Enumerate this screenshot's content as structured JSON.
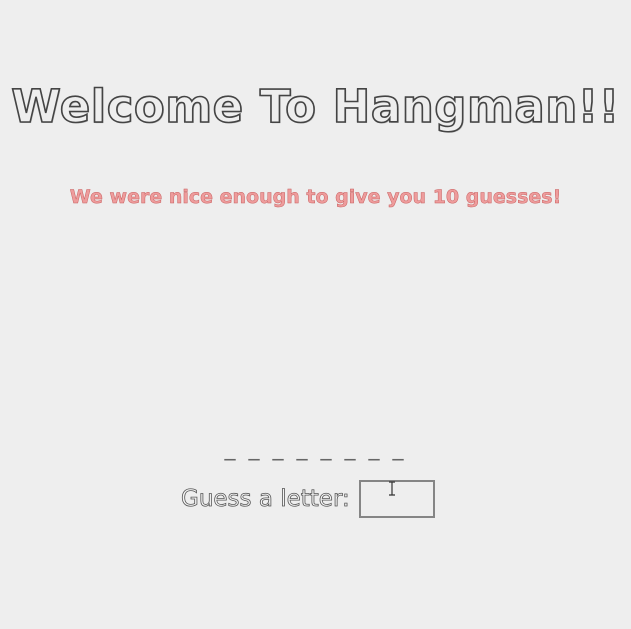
{
  "page": {
    "title": "Welcome To Hangman!!",
    "subtitle": "We were nice enough to give you 10 guesses!"
  },
  "game": {
    "word_display": "_ _ _ _ _ _ _ _",
    "guess_label": "Guess a letter:",
    "guess_value": ""
  },
  "colors": {
    "background": "#eeeeee",
    "title_outline": "#444444",
    "subtitle": "#e08080",
    "input_border": "#858585"
  },
  "icons": {
    "cursor": "text-cursor-icon"
  }
}
